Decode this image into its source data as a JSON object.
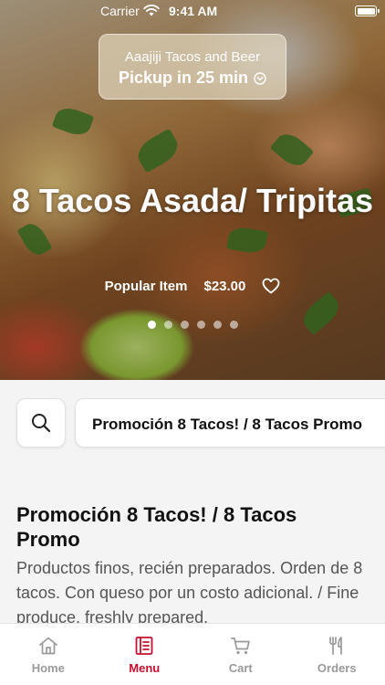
{
  "status_bar": {
    "carrier": "Carrier",
    "time": "9:41 AM"
  },
  "restaurant": {
    "name": "Aaajiji Tacos and Beer",
    "pickup": "Pickup in 25 min"
  },
  "item": {
    "title": "8 Tacos Asada/ Tripitas",
    "badge": "Popular Item",
    "price": "$23.00"
  },
  "carousel": {
    "count": 6,
    "active_index": 0
  },
  "category_bar": {
    "selected": "Promoción 8 Tacos! / 8 Tacos Promo"
  },
  "section": {
    "title": "Promoción 8 Tacos! / 8 Tacos Promo",
    "description": "Productos finos, recién preparados. Orden de 8 tacos. Con queso por un costo adicional. / Fine produce, freshly prepared."
  },
  "tabs": [
    {
      "label": "Home",
      "icon": "home-icon",
      "active": false
    },
    {
      "label": "Menu",
      "icon": "menu-icon",
      "active": true
    },
    {
      "label": "Cart",
      "icon": "cart-icon",
      "active": false
    },
    {
      "label": "Orders",
      "icon": "orders-icon",
      "active": false
    }
  ],
  "colors": {
    "accent": "#c8102e",
    "inactive": "#9a9a9a"
  }
}
